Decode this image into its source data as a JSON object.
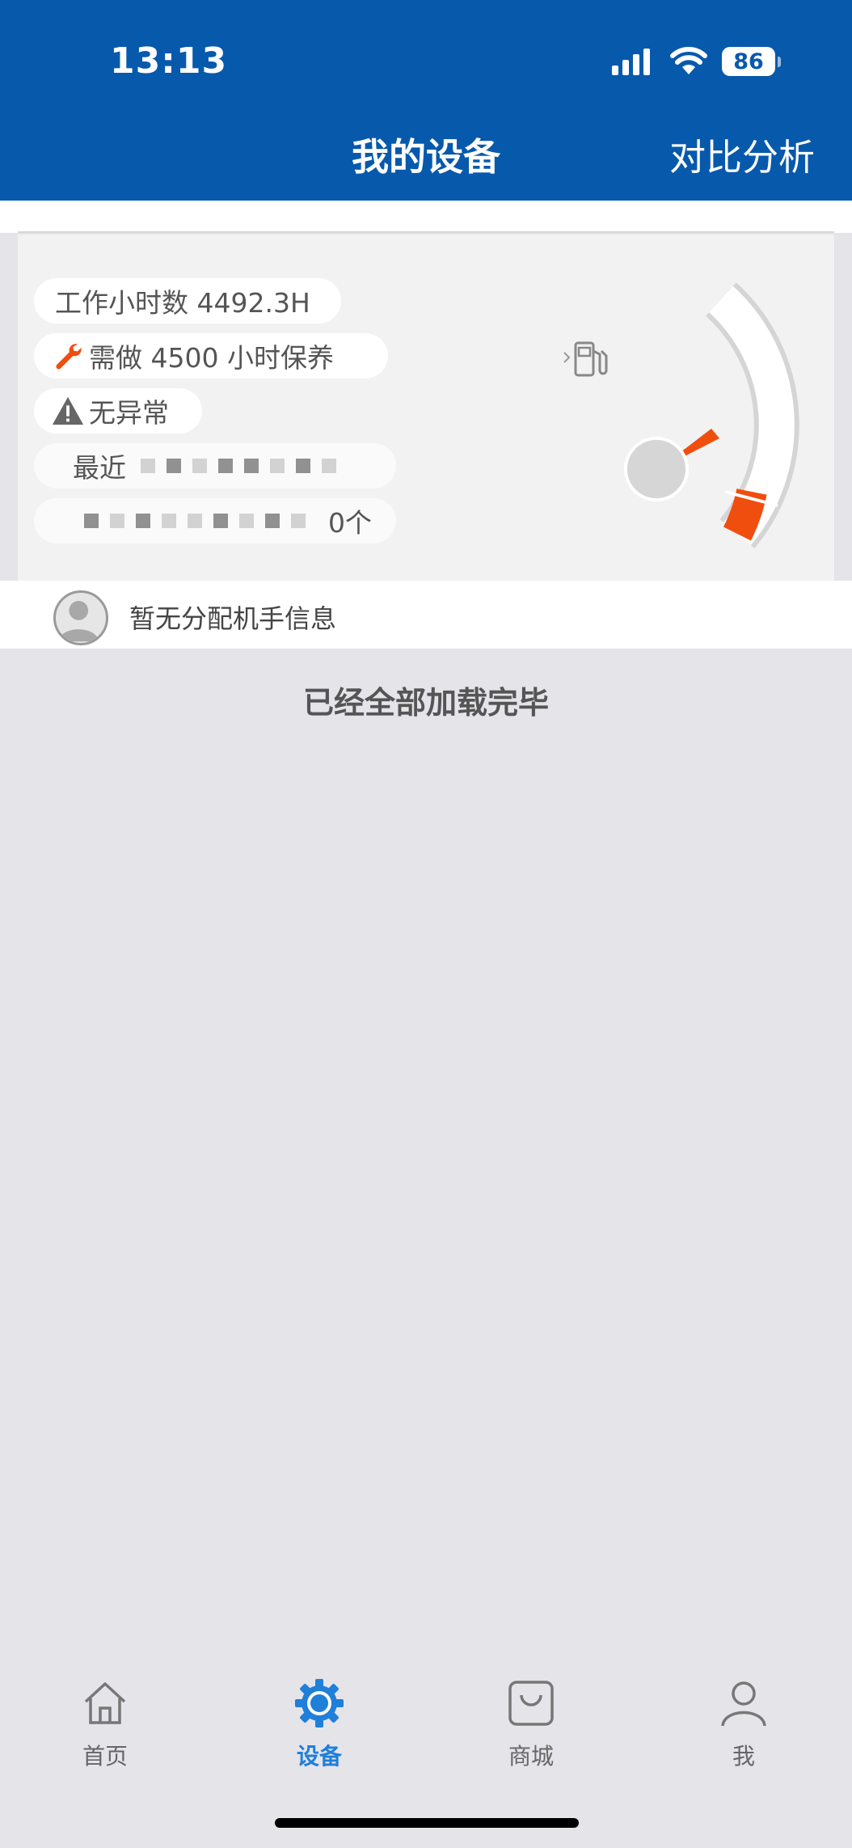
{
  "status_bar": {
    "time": "13:13",
    "battery": "86"
  },
  "header": {
    "title": "我的设备",
    "compare_label": "对比分析"
  },
  "device": {
    "work_hours": "工作小时数 4492.3H",
    "maintenance": "需做 4500 小时保养",
    "alarm_status": "无异常",
    "recent_label": "最近",
    "count_suffix": "0个",
    "accent_color": "#f04e0f"
  },
  "operator": {
    "text": "暂无分配机手信息"
  },
  "list_footer": {
    "text": "已经全部加载完毕"
  },
  "tabs": [
    {
      "label": "首页",
      "icon": "home-icon",
      "active": false
    },
    {
      "label": "设备",
      "icon": "gear-icon",
      "active": true
    },
    {
      "label": "商城",
      "icon": "shopping-bag-icon",
      "active": false
    },
    {
      "label": "我",
      "icon": "person-icon",
      "active": false
    }
  ],
  "colors": {
    "header_bg": "#0759ac",
    "active_tab": "#1f7fd9",
    "page_bg": "#e4e4e9"
  }
}
